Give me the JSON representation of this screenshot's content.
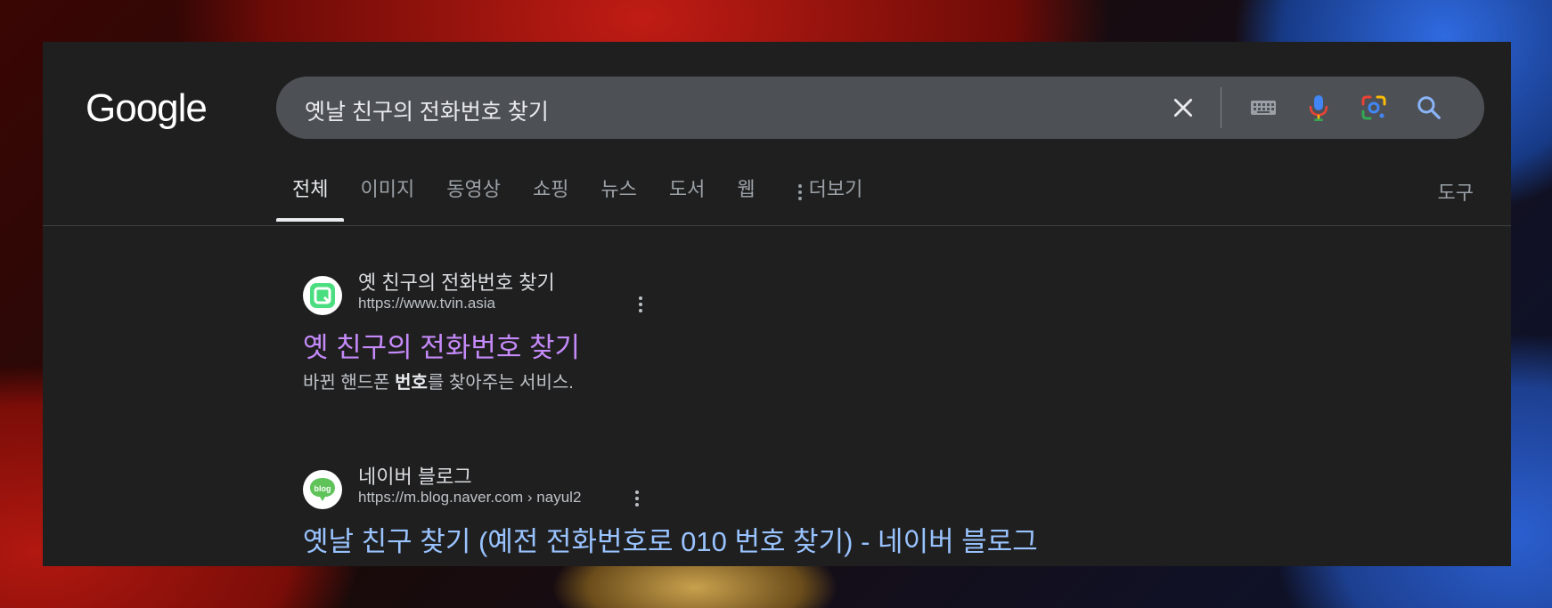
{
  "logo": "Google",
  "search": {
    "query": "옛날 친구의 전화번호 찾기",
    "icons": [
      "close-icon",
      "keyboard-icon",
      "microphone-icon",
      "google-lens-icon",
      "search-icon"
    ]
  },
  "tabs": [
    {
      "label": "전체",
      "active": true
    },
    {
      "label": "이미지"
    },
    {
      "label": "동영상"
    },
    {
      "label": "쇼핑"
    },
    {
      "label": "뉴스"
    },
    {
      "label": "도서"
    },
    {
      "label": "웹"
    }
  ],
  "more_label": "더보기",
  "tools_label": "도구",
  "results": [
    {
      "site_name": "옛 친구의 전화번호 찾기",
      "url": "https://www.tvin.asia",
      "title": "옛 친구의 전화번호 찾기",
      "snippet_before": "바뀐 핸드폰 ",
      "snippet_bold": "번호",
      "snippet_after": "를 찾아주는 서비스.",
      "favicon_color": "#4ade80"
    },
    {
      "site_name": "네이버 블로그",
      "url": "https://m.blog.naver.com › nayul2",
      "title": "옛날 친구 찾기 (예전 전화번호로 010 번호 찾기) - 네이버 블로그",
      "favicon_text": "blog",
      "favicon_color": "#5fc35a"
    }
  ],
  "colors": {
    "page_bg": "#1f1f1f",
    "search_bg": "#4d5156",
    "visited_link": "#c58af9",
    "link": "#99c3ff"
  }
}
